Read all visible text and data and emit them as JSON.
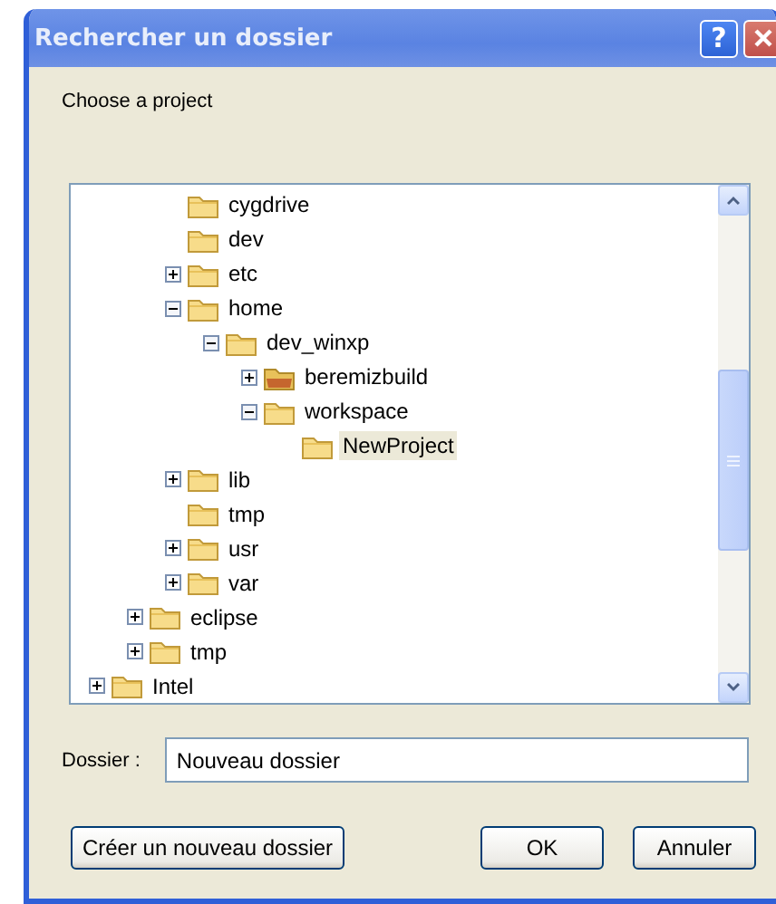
{
  "window": {
    "title": "Rechercher un dossier",
    "help_label": "?"
  },
  "prompt": "Choose a project",
  "tree": {
    "children": [
      {
        "children": [
          {
            "children": [
              {
                "label": "cygdrive",
                "expandable": false,
                "kind": "folder",
                "selected": false
              },
              {
                "label": "dev",
                "expandable": false,
                "kind": "folder",
                "selected": false
              },
              {
                "label": "etc",
                "expandable": true,
                "expanded": false,
                "kind": "folder",
                "selected": false
              },
              {
                "label": "home",
                "expandable": true,
                "expanded": true,
                "kind": "folder",
                "selected": false,
                "children": [
                  {
                    "label": "dev_winxp",
                    "expandable": true,
                    "expanded": true,
                    "kind": "folder",
                    "selected": false,
                    "children": [
                      {
                        "label": "beremizbuild",
                        "expandable": true,
                        "expanded": false,
                        "kind": "filled",
                        "selected": false
                      },
                      {
                        "label": "workspace",
                        "expandable": true,
                        "expanded": true,
                        "kind": "folder",
                        "selected": false,
                        "children": [
                          {
                            "label": "NewProject",
                            "expandable": false,
                            "kind": "folder",
                            "selected": true
                          }
                        ]
                      }
                    ]
                  }
                ]
              },
              {
                "label": "lib",
                "expandable": true,
                "expanded": false,
                "kind": "folder",
                "selected": false
              },
              {
                "label": "tmp",
                "expandable": false,
                "kind": "folder",
                "selected": false
              },
              {
                "label": "usr",
                "expandable": true,
                "expanded": false,
                "kind": "folder",
                "selected": false
              },
              {
                "label": "var",
                "expandable": true,
                "expanded": false,
                "kind": "folder",
                "selected": false
              }
            ]
          },
          {
            "label": "eclipse",
            "expandable": true,
            "expanded": false,
            "kind": "folder",
            "selected": false
          },
          {
            "label": "tmp",
            "expandable": true,
            "expanded": false,
            "kind": "folder",
            "selected": false
          }
        ]
      },
      {
        "label": "Intel",
        "expandable": true,
        "expanded": false,
        "kind": "folder",
        "selected": false
      }
    ]
  },
  "folder_field": {
    "label": "Dossier :",
    "value": "Nouveau dossier"
  },
  "buttons": {
    "new_folder": "Créer un nouveau dossier",
    "ok": "OK",
    "cancel": "Annuler"
  }
}
